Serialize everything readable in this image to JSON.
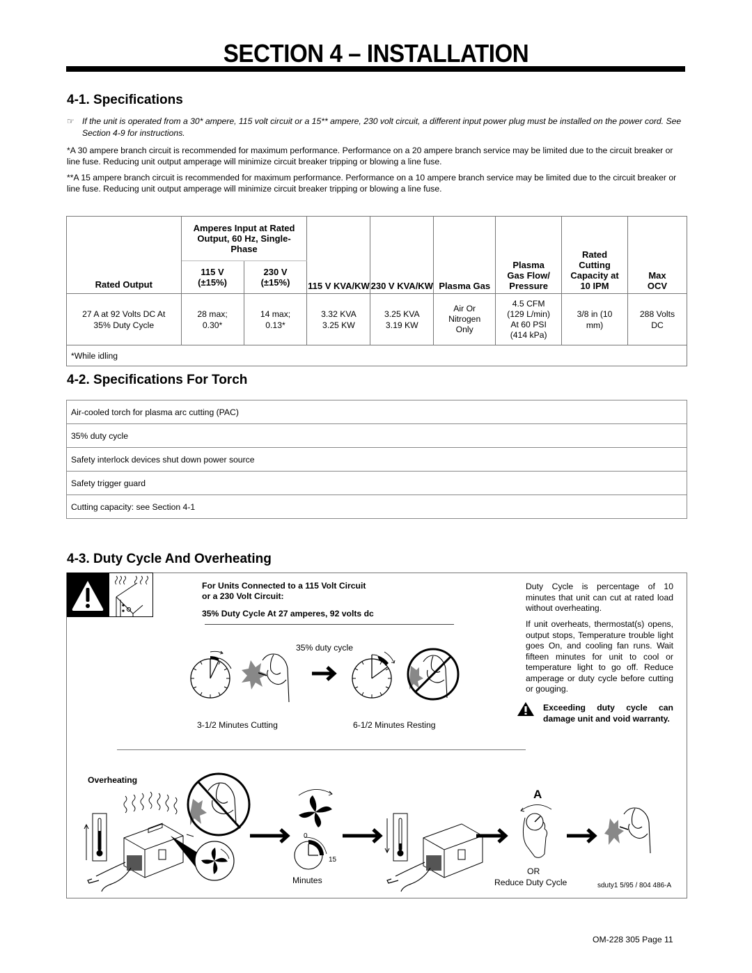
{
  "page_title": "SECTION 4 – INSTALLATION",
  "sections": {
    "s41": "4-1.  Specifications",
    "s42": "4-2.  Specifications For Torch",
    "s43": "4-3.  Duty Cycle And Overheating"
  },
  "note": "If the unit is operated from a 30* ampere, 115 volt circuit or a 15** ampere, 230 volt circuit, a different input power plug must be installed on the power cord. See Section 4-9 for instructions.",
  "footnote1": "*A 30 ampere branch circuit is recommended for maximum performance. Performance on a 20 ampere branch service may be limited due to the circuit breaker or line fuse. Reducing unit output amperage will minimize circuit breaker tripping or blowing a line fuse.",
  "footnote2": "**A 15 ampere branch circuit is recommended for maximum performance. Performance on a 10 ampere branch service may be limited due to the circuit breaker or line fuse. Reducing unit output amperage will minimize circuit breaker tripping or blowing a line fuse.",
  "spec_table": {
    "group_header": "Amperes Input at Rated Output, 60 Hz, Single-Phase",
    "headers": {
      "rated_output": "Rated Output",
      "a115": "115 V (±15%)",
      "a230": "230 V (±15%)",
      "kva115": "115 V KVA/KW",
      "kva230": "230 V KVA/KW",
      "gas": "Plasma Gas",
      "flow": "Plasma Gas Flow/ Pressure",
      "capacity": "Rated Cutting Capacity at 10 IPM",
      "ocv": "Max OCV"
    },
    "row": {
      "rated_output": "27 A at 92 Volts DC At 35% Duty Cycle",
      "a115": "28 max; 0.30*",
      "a230": "14 max; 0.13*",
      "kva115": "3.32 KVA 3.25 KW",
      "kva230": "3.25 KVA 3.19 KW",
      "gas": "Air Or Nitrogen Only",
      "flow": "4.5 CFM (129 L/min) At 60 PSI (414 kPa)",
      "capacity": "3/8 in (10 mm)",
      "ocv": "288 Volts DC"
    },
    "footnote": "*While idling"
  },
  "torch_specs": [
    "Air-cooled torch for plasma arc cutting (PAC)",
    "35% duty cycle",
    "Safety interlock devices shut down power source",
    "Safety trigger guard",
    "Cutting capacity: see Section 4-1"
  ],
  "duty": {
    "heading1": "For Units Connected to a 115 Volt Circuit",
    "heading2": "or a 230 Volt Circuit:",
    "subheading": "35% Duty Cycle At 27 amperes, 92 volts dc",
    "duty_label": "35% duty cycle",
    "cutting_label": "3-1/2 Minutes Cutting",
    "resting_label": "6-1/2 Minutes Resting",
    "desc1": "Duty Cycle is percentage of 10 minutes that unit can cut at rated load without overheating.",
    "desc2": "If unit overheats, thermostat(s) opens, output stops, Temperature trouble light goes On, and cooling fan runs. Wait fifteen minutes for unit to cool or temperature light to go off. Reduce amperage or duty cycle before cutting or gouging.",
    "warning": "Exceeding duty cycle can damage unit and void warranty.",
    "overheating_label": "Overheating",
    "timer_zero": "0",
    "timer_fifteen": "15",
    "minutes_label": "Minutes",
    "amp_label": "A",
    "or_label": "OR",
    "reduce_label": "Reduce Duty Cycle",
    "figure_ref": "sduty1 5/95 / 804 486-A"
  },
  "page_footer": "OM-228 305 Page 11"
}
